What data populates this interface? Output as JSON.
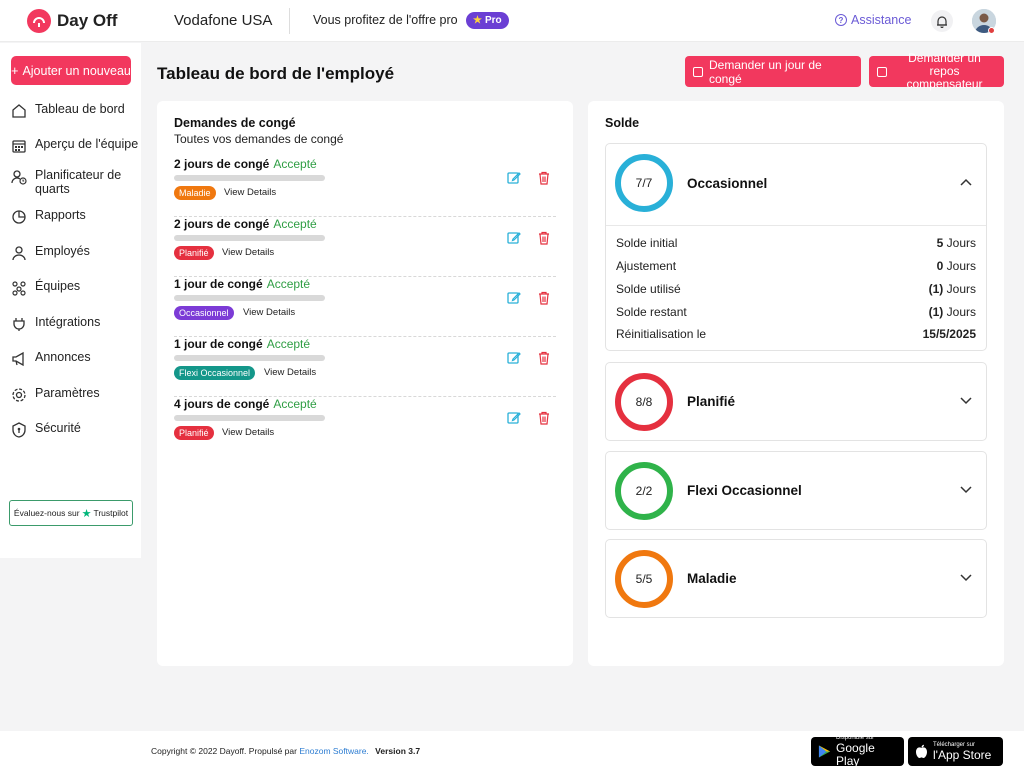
{
  "header": {
    "logo_text": "Day Off",
    "company": "Vodafone USA",
    "offer_text": "Vous profitez de l'offre pro",
    "pro_badge": "Pro",
    "assistance": "Assistance"
  },
  "sidebar": {
    "add_button": "Ajouter un nouveau",
    "items": [
      {
        "label": "Tableau de bord",
        "icon": "home-icon"
      },
      {
        "label": "Aperçu de l'équipe",
        "icon": "calendar-grid-icon"
      },
      {
        "label": "Planificateur de quarts",
        "icon": "user-clock-icon"
      },
      {
        "label": "Rapports",
        "icon": "pie-chart-icon"
      },
      {
        "label": "Employés",
        "icon": "user-icon"
      },
      {
        "label": "Équipes",
        "icon": "team-icon"
      },
      {
        "label": "Intégrations",
        "icon": "plug-icon"
      },
      {
        "label": "Annonces",
        "icon": "megaphone-icon"
      },
      {
        "label": "Paramètres",
        "icon": "gear-icon"
      },
      {
        "label": "Sécurité",
        "icon": "shield-icon"
      }
    ],
    "trustpilot_prefix": "Évaluez-nous sur",
    "trustpilot_brand": "Trustpilot"
  },
  "main": {
    "title": "Tableau de bord de l'employé",
    "request_leave_button": "Demander un jour de congé",
    "request_comp_button_line1": "Demander un repos",
    "request_comp_button_line2": "compensateur"
  },
  "leave_requests": {
    "title": "Demandes de congé",
    "subtitle": "Toutes vos demandes de congé",
    "view_details": "View Details",
    "items": [
      {
        "title": "2 jours de congé",
        "status": "Accepté",
        "type": "Maladie",
        "type_color": "#f0780f"
      },
      {
        "title": "2 jours de congé",
        "status": "Accepté",
        "type": "Planifié",
        "type_color": "#e5303f"
      },
      {
        "title": "1 jour de congé",
        "status": "Accepté",
        "type": "Occasionnel",
        "type_color": "#7c3bd6"
      },
      {
        "title": "1 jour de congé",
        "status": "Accepté",
        "type": "Flexi Occasionnel",
        "type_color": "#14978a"
      },
      {
        "title": "4 jours de congé",
        "status": "Accepté",
        "type": "Planifié",
        "type_color": "#e5303f"
      }
    ]
  },
  "balance": {
    "title": "Solde",
    "types": [
      {
        "name": "Occasionnel",
        "ring": "7/7",
        "color": "#29b0d8",
        "expanded": true,
        "details": [
          {
            "label": "Solde initial",
            "value": "5",
            "unit": "Jours"
          },
          {
            "label": "Ajustement",
            "value": "0",
            "unit": "Jours"
          },
          {
            "label": "Solde utilisé",
            "value": "(1)",
            "unit": "Jours"
          },
          {
            "label": "Solde restant",
            "value": "(1)",
            "unit": "Jours"
          },
          {
            "label": "Réinitialisation le",
            "value": "15/5/2025",
            "unit": ""
          }
        ]
      },
      {
        "name": "Planifié",
        "ring": "8/8",
        "color": "#e5303f",
        "expanded": false
      },
      {
        "name": "Flexi Occasionnel",
        "ring": "2/2",
        "color": "#2fb34a",
        "expanded": false
      },
      {
        "name": "Maladie",
        "ring": "5/5",
        "color": "#f0780f",
        "expanded": false
      }
    ]
  },
  "footer": {
    "copyright": "Copyright © 2022 Dayoff. Propulsé par",
    "brand": "Enozom Software.",
    "version": "Version 3.7",
    "google_small": "Disponible sur",
    "google_big": "Google Play",
    "apple_small": "Télécharger sur",
    "apple_big": "l'App Store"
  },
  "colors": {
    "accent": "#f2385e",
    "accepted": "#2f9e44",
    "pro": "#6b3fd4"
  }
}
